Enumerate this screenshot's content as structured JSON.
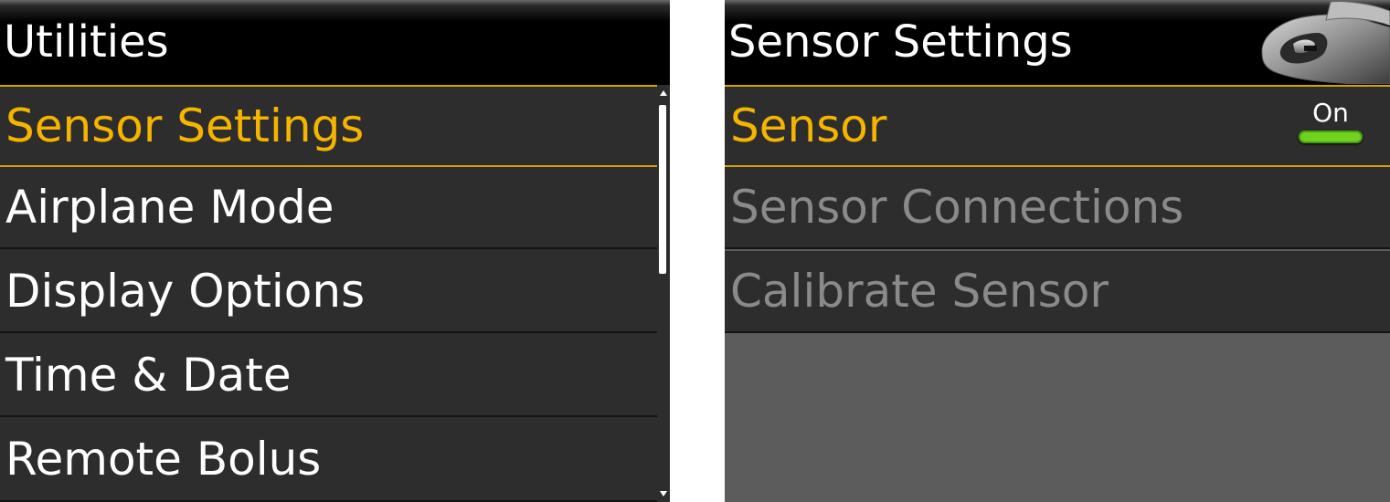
{
  "left_screen": {
    "title": "Utilities",
    "items": [
      {
        "label": "Sensor Settings"
      },
      {
        "label": "Airplane Mode"
      },
      {
        "label": "Display Options"
      },
      {
        "label": "Time & Date"
      },
      {
        "label": "Remote Bolus"
      }
    ]
  },
  "right_screen": {
    "title": "Sensor Settings",
    "items": [
      {
        "label": "Sensor",
        "toggle_label": "On"
      },
      {
        "label": "Sensor Connections"
      },
      {
        "label": "Calibrate Sensor"
      }
    ]
  },
  "colors": {
    "selected_text": "#f5b400",
    "selected_border": "#d5a500",
    "disabled_text": "#8a8a8a",
    "toggle_on": "#6fd31c",
    "item_background": "#2d2d2d"
  },
  "icons": {
    "scroll_up": "triangle-up",
    "scroll_down": "triangle-down",
    "sensor_graphic": "sensor-device-image"
  }
}
